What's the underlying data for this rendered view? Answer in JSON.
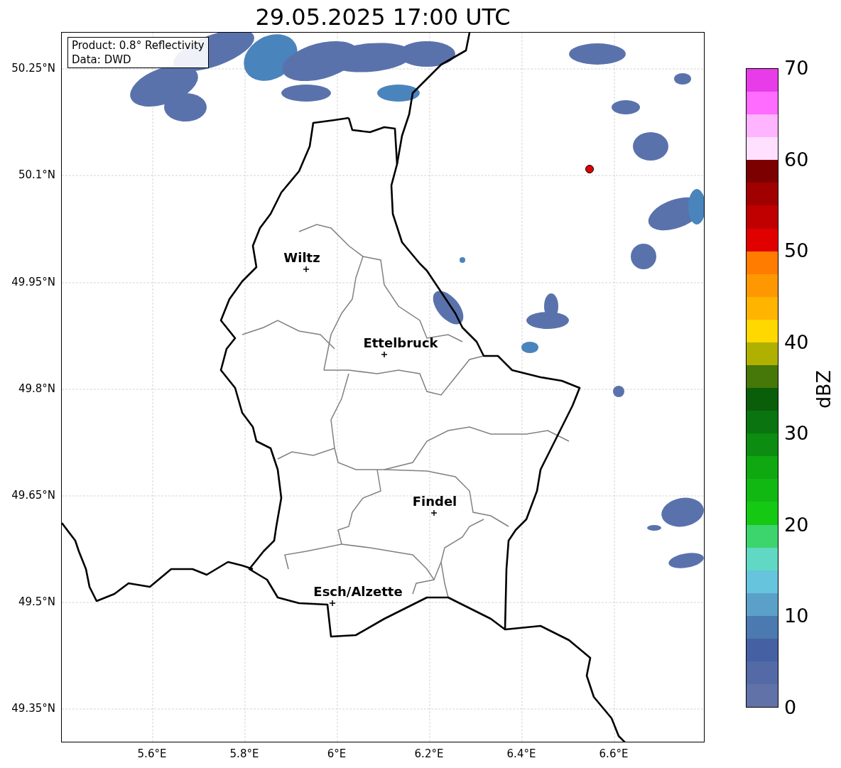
{
  "title": "29.05.2025 17:00 UTC",
  "info_box": {
    "lines": [
      "Product: 0.8° Reflectivity",
      "Data: DWD"
    ]
  },
  "map": {
    "lat_labels": [
      "50.25°N",
      "50.1°N",
      "49.95°N",
      "49.8°N",
      "49.65°N",
      "49.5°N",
      "49.35°N"
    ],
    "lon_labels": [
      "5.6°E",
      "5.8°E",
      "6°E",
      "6.2°E",
      "6.4°E",
      "6.6°E"
    ],
    "cities": [
      {
        "name": "Wiltz"
      },
      {
        "name": "Ettelbruck"
      },
      {
        "name": "Findel"
      },
      {
        "name": "Esch/Alzette"
      }
    ]
  },
  "colorbar": {
    "label": "dBZ",
    "ticks": [
      "70",
      "60",
      "50",
      "40",
      "30",
      "20",
      "10",
      "0"
    ],
    "segments": [
      {
        "color": "#e83ce8"
      },
      {
        "color": "#ff6cff"
      },
      {
        "color": "#ffb4ff"
      },
      {
        "color": "#ffe0ff"
      },
      {
        "color": "#7c0000"
      },
      {
        "color": "#a00000"
      },
      {
        "color": "#c00000"
      },
      {
        "color": "#e00000"
      },
      {
        "color": "#ff7c00"
      },
      {
        "color": "#ff9800"
      },
      {
        "color": "#ffb400"
      },
      {
        "color": "#ffd800"
      },
      {
        "color": "#b0b000"
      },
      {
        "color": "#457808"
      },
      {
        "color": "#0a5e0a"
      },
      {
        "color": "#0a7410"
      },
      {
        "color": "#0c8c10"
      },
      {
        "color": "#10a810"
      },
      {
        "color": "#12b812"
      },
      {
        "color": "#14c814"
      },
      {
        "color": "#3cd46c"
      },
      {
        "color": "#60d8c4"
      },
      {
        "color": "#66c4dc"
      },
      {
        "color": "#5aa0c8"
      },
      {
        "color": "#4a7ab0"
      },
      {
        "color": "#4660a4"
      },
      {
        "color": "#536aa6"
      },
      {
        "color": "#6172a8"
      }
    ]
  }
}
